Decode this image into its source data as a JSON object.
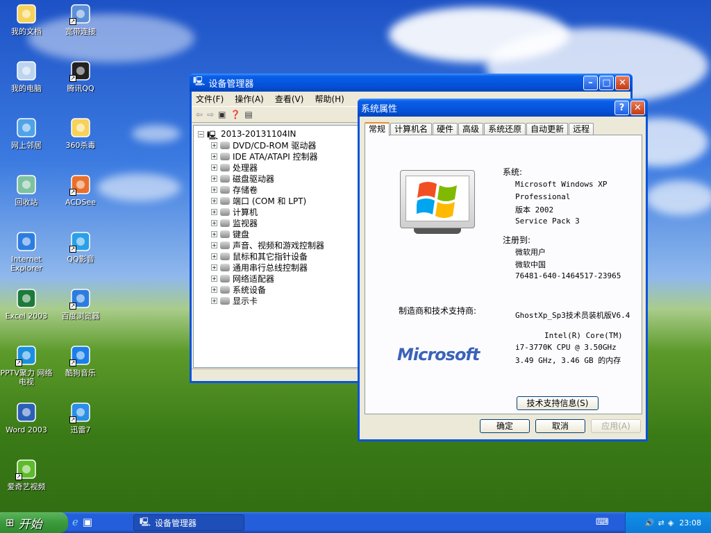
{
  "desktop": {
    "icons": [
      {
        "label": "我的文档",
        "icon": "my-documents-icon",
        "shortcut": false
      },
      {
        "label": "宽带连接",
        "icon": "broadband-connection-icon",
        "shortcut": true
      },
      {
        "label": "我的电脑",
        "icon": "my-computer-icon",
        "shortcut": false
      },
      {
        "label": "腾讯QQ",
        "icon": "qq-icon",
        "shortcut": true
      },
      {
        "label": "网上邻居",
        "icon": "network-places-icon",
        "shortcut": false
      },
      {
        "label": "360杀毒",
        "icon": "folder-icon",
        "shortcut": false
      },
      {
        "label": "回收站",
        "icon": "recycle-bin-icon",
        "shortcut": false
      },
      {
        "label": "ACDSee",
        "icon": "acdsee-icon",
        "shortcut": true
      },
      {
        "label": "Internet Explorer",
        "icon": "internet-explorer-icon",
        "shortcut": false
      },
      {
        "label": "QQ影音",
        "icon": "qq-player-icon",
        "shortcut": true
      },
      {
        "label": "Excel 2003",
        "icon": "excel-icon",
        "shortcut": false
      },
      {
        "label": "百度浏览器",
        "icon": "baidu-browser-icon",
        "shortcut": true
      },
      {
        "label": "PPTV聚力 网络电视",
        "icon": "pptv-icon",
        "shortcut": true
      },
      {
        "label": "酷狗音乐",
        "icon": "kugou-icon",
        "shortcut": true
      },
      {
        "label": "Word 2003",
        "icon": "word-icon",
        "shortcut": false
      },
      {
        "label": "迅雷7",
        "icon": "thunder-icon",
        "shortcut": true
      },
      {
        "label": "爱奇艺视频",
        "icon": "iqiyi-icon",
        "shortcut": true
      }
    ]
  },
  "device_manager": {
    "title": "设备管理器",
    "menu": [
      "文件(F)",
      "操作(A)",
      "查看(V)",
      "帮助(H)"
    ],
    "root": "2013-20131104IN",
    "items": [
      "DVD/CD-ROM 驱动器",
      "IDE ATA/ATAPI 控制器",
      "处理器",
      "磁盘驱动器",
      "存储卷",
      "端口 (COM 和 LPT)",
      "计算机",
      "监视器",
      "键盘",
      "声音、视频和游戏控制器",
      "鼠标和其它指针设备",
      "通用串行总线控制器",
      "网络适配器",
      "系统设备",
      "显示卡"
    ]
  },
  "system_properties": {
    "title": "系统属性",
    "tabs": [
      "常规",
      "计算机名",
      "硬件",
      "高级",
      "系统还原",
      "自动更新",
      "远程"
    ],
    "system_label": "系统:",
    "system_lines": [
      "Microsoft Windows XP",
      "Professional",
      "版本 2002",
      "Service Pack 3"
    ],
    "registered_label": "注册到:",
    "registered_lines": [
      "微软用户",
      "微软中国",
      "76481-640-1464517-23965"
    ],
    "manufacturer_label": "制造商和技术支持商:",
    "manufacturer_value": "GhostXp_Sp3技术员装机版V6.4",
    "cpu_lines": [
      "Intel(R) Core(TM)",
      "i7-3770K CPU @ 3.50GHz",
      "3.49 GHz, 3.46 GB 的内存"
    ],
    "logo_text": "Microsoft",
    "support_button": "技术支持信息(S)",
    "ok": "确定",
    "cancel": "取消",
    "apply": "应用(A)"
  },
  "taskbar": {
    "start": "开始",
    "task": "设备管理器",
    "clock": "23:08"
  }
}
